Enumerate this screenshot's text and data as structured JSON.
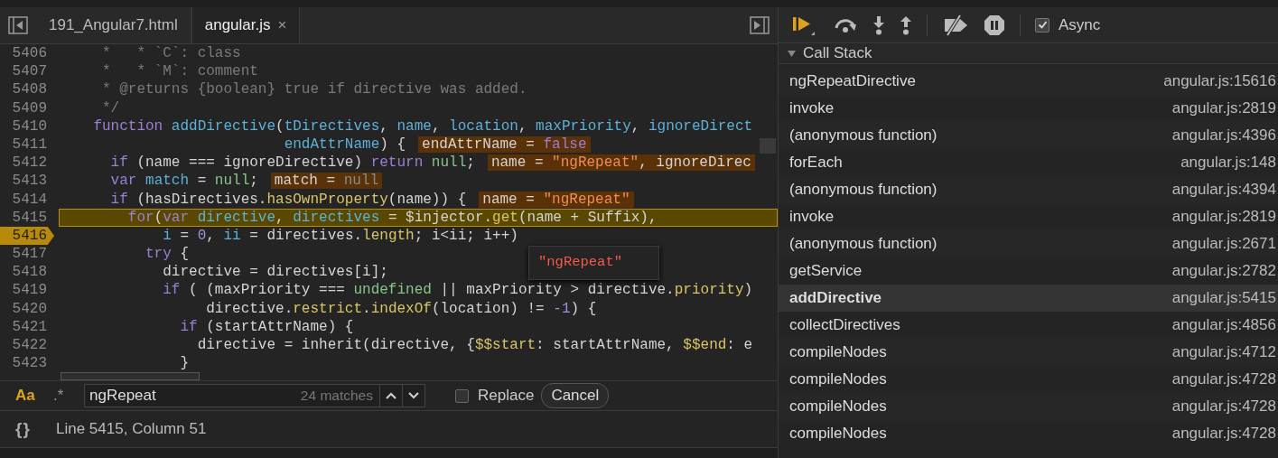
{
  "tabs": [
    {
      "label": "191_Angular7.html",
      "selected": false
    },
    {
      "label": "angular.js",
      "selected": true,
      "close": "×"
    }
  ],
  "editor": {
    "lines": [
      {
        "number": "5406",
        "highlighted": false,
        "paused": false,
        "segments": [
          {
            "text": "     *   * `C`: class",
            "kind": "comment"
          }
        ]
      },
      {
        "number": "5407",
        "highlighted": false,
        "paused": false,
        "segments": [
          {
            "text": "     *   * `M`: comment",
            "kind": "comment"
          }
        ]
      },
      {
        "number": "5408",
        "highlighted": false,
        "paused": false,
        "segments": [
          {
            "text": "     * @returns {boolean} true if directive was added.",
            "kind": "comment"
          }
        ]
      },
      {
        "number": "5409",
        "highlighted": false,
        "paused": false,
        "segments": [
          {
            "text": "     */",
            "kind": "comment"
          }
        ]
      },
      {
        "number": "5410",
        "highlighted": false,
        "paused": false,
        "segments": [
          {
            "text": "    function",
            "kind": "keyword"
          },
          {
            "text": " addDirective",
            "kind": "name"
          },
          {
            "text": "(",
            "kind": "plain"
          },
          {
            "text": "tDirectives",
            "kind": "name"
          },
          {
            "text": ", ",
            "kind": "plain"
          },
          {
            "text": "name",
            "kind": "name"
          },
          {
            "text": ", ",
            "kind": "plain"
          },
          {
            "text": "location",
            "kind": "name"
          },
          {
            "text": ", ",
            "kind": "plain"
          },
          {
            "text": "maxPriority",
            "kind": "name"
          },
          {
            "text": ", ",
            "kind": "plain"
          },
          {
            "text": "ignoreDirect",
            "kind": "name"
          }
        ]
      },
      {
        "number": "5411",
        "highlighted": false,
        "paused": false,
        "segments": [
          {
            "text": "                          endAttrName",
            "kind": "name"
          },
          {
            "text": ") {",
            "kind": "plain"
          }
        ],
        "value": [
          {
            "text": "endAttrName = ",
            "kind": "plain"
          },
          {
            "text": "false",
            "kind": "keyword"
          }
        ]
      },
      {
        "number": "5412",
        "highlighted": false,
        "paused": false,
        "segments": [
          {
            "text": "      if",
            "kind": "keyword"
          },
          {
            "text": " (name === ignoreDirective) ",
            "kind": "plain"
          },
          {
            "text": "return",
            "kind": "keyword"
          },
          {
            "text": " null",
            "kind": "literal"
          },
          {
            "text": ";",
            "kind": "plain"
          }
        ],
        "value": [
          {
            "text": "name = ",
            "kind": "plain"
          },
          {
            "text": "\"ngRepeat\"",
            "kind": "string"
          },
          {
            "text": ", ignoreDirec",
            "kind": "plain"
          }
        ]
      },
      {
        "number": "5413",
        "highlighted": false,
        "paused": false,
        "segments": [
          {
            "text": "      var",
            "kind": "keyword"
          },
          {
            "text": " match",
            "kind": "name"
          },
          {
            "text": " = ",
            "kind": "plain"
          },
          {
            "text": "null",
            "kind": "literal"
          },
          {
            "text": ";",
            "kind": "plain"
          }
        ],
        "value": [
          {
            "text": "match = ",
            "kind": "plain"
          },
          {
            "text": "null",
            "kind": "muted"
          }
        ]
      },
      {
        "number": "5414",
        "highlighted": false,
        "paused": false,
        "segments": [
          {
            "text": "      if",
            "kind": "keyword"
          },
          {
            "text": " (hasDirectives.",
            "kind": "plain"
          },
          {
            "text": "hasOwnProperty",
            "kind": "property"
          },
          {
            "text": "(name)) {",
            "kind": "plain"
          }
        ],
        "value": [
          {
            "text": "name = ",
            "kind": "plain"
          },
          {
            "text": "\"ngRepeat\"",
            "kind": "string"
          }
        ]
      },
      {
        "number": "5415",
        "highlighted": true,
        "paused": false,
        "segments": [
          {
            "text": "        for",
            "kind": "keyword"
          },
          {
            "text": "(",
            "kind": "plain"
          },
          {
            "text": "var",
            "kind": "keyword"
          },
          {
            "text": " directive",
            "kind": "name"
          },
          {
            "text": ", ",
            "kind": "plain"
          },
          {
            "text": "directives",
            "kind": "name"
          },
          {
            "text": " = $injector.",
            "kind": "plain"
          },
          {
            "text": "get",
            "kind": "property"
          },
          {
            "text": "(name + Suffix),",
            "kind": "plain"
          }
        ]
      },
      {
        "number": "5416",
        "highlighted": false,
        "paused": true,
        "segments": [
          {
            "text": "            i",
            "kind": "name"
          },
          {
            "text": " = ",
            "kind": "plain"
          },
          {
            "text": "0",
            "kind": "number"
          },
          {
            "text": ", ",
            "kind": "plain"
          },
          {
            "text": "ii",
            "kind": "name"
          },
          {
            "text": " = directives.",
            "kind": "plain"
          },
          {
            "text": "length",
            "kind": "property"
          },
          {
            "text": "; i<ii; i++)",
            "kind": "plain"
          }
        ]
      },
      {
        "number": "5417",
        "highlighted": false,
        "paused": false,
        "segments": [
          {
            "text": "          try",
            "kind": "keyword"
          },
          {
            "text": " {",
            "kind": "plain"
          }
        ]
      },
      {
        "number": "5418",
        "highlighted": false,
        "paused": false,
        "segments": [
          {
            "text": "            directive = directives[i];",
            "kind": "plain"
          }
        ]
      },
      {
        "number": "5419",
        "highlighted": false,
        "paused": false,
        "segments": [
          {
            "text": "            if",
            "kind": "keyword"
          },
          {
            "text": " ( (maxPriority === ",
            "kind": "plain"
          },
          {
            "text": "undefined",
            "kind": "literal"
          },
          {
            "text": " || maxPriority > directive.",
            "kind": "plain"
          },
          {
            "text": "priority",
            "kind": "property"
          },
          {
            "text": ")",
            "kind": "plain"
          }
        ]
      },
      {
        "number": "5420",
        "highlighted": false,
        "paused": false,
        "segments": [
          {
            "text": "                 directive.",
            "kind": "plain"
          },
          {
            "text": "restrict",
            "kind": "property"
          },
          {
            "text": ".",
            "kind": "plain"
          },
          {
            "text": "indexOf",
            "kind": "property"
          },
          {
            "text": "(location) != ",
            "kind": "plain"
          },
          {
            "text": "-1",
            "kind": "number"
          },
          {
            "text": ") {",
            "kind": "plain"
          }
        ]
      },
      {
        "number": "5421",
        "highlighted": false,
        "paused": false,
        "segments": [
          {
            "text": "              if",
            "kind": "keyword"
          },
          {
            "text": " (startAttrName) {",
            "kind": "plain"
          }
        ]
      },
      {
        "number": "5422",
        "highlighted": false,
        "paused": false,
        "segments": [
          {
            "text": "                directive = inherit(directive, {",
            "kind": "plain"
          },
          {
            "text": "$$start",
            "kind": "property"
          },
          {
            "text": ": startAttrName, ",
            "kind": "plain"
          },
          {
            "text": "$$end",
            "kind": "property"
          },
          {
            "text": ": e",
            "kind": "plain"
          }
        ]
      },
      {
        "number": "5423",
        "highlighted": false,
        "paused": false,
        "segments": [
          {
            "text": "              }",
            "kind": "plain"
          }
        ]
      }
    ],
    "tooltip": "\"ngRepeat\""
  },
  "search": {
    "case_toggle": {
      "label": "Aa",
      "on": true
    },
    "regex_toggle": {
      "label": ".*",
      "on": false
    },
    "value": "ngRepeat",
    "matches": "24 matches",
    "replace": {
      "label": "Replace",
      "checked": false
    },
    "cancel": "Cancel"
  },
  "status": {
    "format_button": "{}",
    "position": "Line 5415, Column 51"
  },
  "debugger": {
    "async": {
      "label": "Async",
      "checked": true
    },
    "call_stack": {
      "title": "Call Stack",
      "expanded": true,
      "frames": [
        {
          "name": "ngRepeatDirective",
          "location": "angular.js:15616",
          "selected": false
        },
        {
          "name": "invoke",
          "location": "angular.js:2819",
          "selected": false
        },
        {
          "name": "(anonymous function)",
          "location": "angular.js:4396",
          "selected": false
        },
        {
          "name": "forEach",
          "location": "angular.js:148",
          "selected": false
        },
        {
          "name": "(anonymous function)",
          "location": "angular.js:4394",
          "selected": false
        },
        {
          "name": "invoke",
          "location": "angular.js:2819",
          "selected": false
        },
        {
          "name": "(anonymous function)",
          "location": "angular.js:2671",
          "selected": false
        },
        {
          "name": "getService",
          "location": "angular.js:2782",
          "selected": false
        },
        {
          "name": "addDirective",
          "location": "angular.js:5415",
          "selected": true
        },
        {
          "name": "collectDirectives",
          "location": "angular.js:4856",
          "selected": false
        },
        {
          "name": "compileNodes",
          "location": "angular.js:4712",
          "selected": false
        },
        {
          "name": "compileNodes",
          "location": "angular.js:4728",
          "selected": false
        },
        {
          "name": "compileNodes",
          "location": "angular.js:4728",
          "selected": false
        },
        {
          "name": "compileNodes",
          "location": "angular.js:4728",
          "selected": false
        }
      ]
    }
  }
}
